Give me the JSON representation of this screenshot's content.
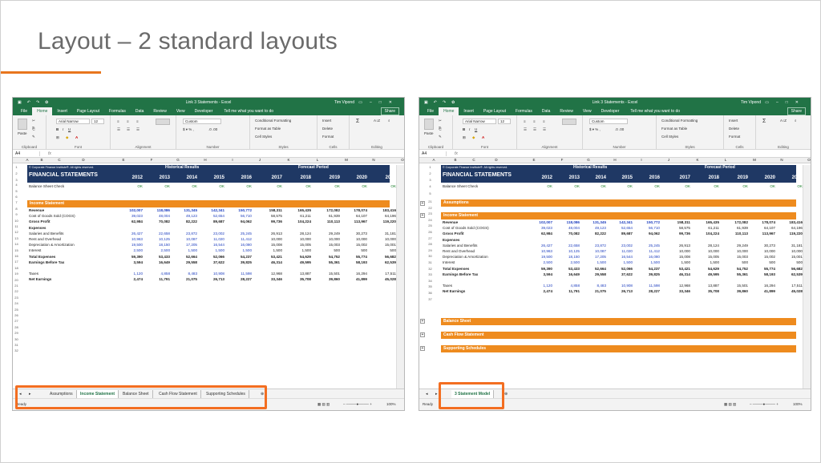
{
  "slide_title": "Layout – 2 standard layouts",
  "accent_color": "#e8761e",
  "excel_green": "#217346",
  "highlight_color": "#f36e21",
  "window_title": "Link 3 Statements - Excel",
  "user": "Tim Vipond",
  "ribbon_tabs": [
    "File",
    "Home",
    "Insert",
    "Page Layout",
    "Formulas",
    "Data",
    "Review",
    "View",
    "Developer"
  ],
  "tell_me": "Tell me what you want to do",
  "share": "Share",
  "font_name": "Arial Narrow",
  "font_size": "12",
  "number_format": "Custom",
  "name_box": "A4",
  "ribbon_labels": {
    "clipboard": "Clipboard",
    "font": "Font",
    "alignment": "Alignment",
    "number": "Number",
    "styles": "Styles",
    "cells": "Cells",
    "editing": "Editing",
    "paste": "Paste",
    "cond": "Conditional Formatting",
    "table": "Format as Table",
    "cellstyles": "Cell Styles",
    "insert": "Insert",
    "delete": "Delete",
    "format": "Format"
  },
  "columns": [
    "A",
    "B",
    "C",
    "D",
    "E",
    "F",
    "G",
    "H",
    "I",
    "J",
    "K",
    "L",
    "M",
    "N",
    "O"
  ],
  "header": {
    "copyright": "© Corporate Finance Institute®. All rights reserved.",
    "historical": "Historical Results",
    "forecast": "Forecast Period",
    "fs": "FINANCIAL STATEMENTS",
    "check": "Balance Sheet Check",
    "ok": "OK"
  },
  "years": [
    "2012",
    "2013",
    "2014",
    "2015",
    "2016",
    "2017",
    "2018",
    "2019",
    "2020",
    "2021"
  ],
  "income_label": "Income Statement",
  "rows": [
    {
      "label": "Revenue",
      "bold": true,
      "v": [
        "102,007",
        "118,086",
        "131,345",
        "142,341",
        "150,772",
        "158,311",
        "165,435",
        "172,082",
        "178,074",
        "183,416"
      ]
    },
    {
      "label": "Cost of Goods Sold (COGS)",
      "v": [
        "39,023",
        "48,004",
        "49,123",
        "52,654",
        "56,710",
        "58,575",
        "61,211",
        "61,939",
        "64,107",
        "64,196"
      ]
    },
    {
      "label": "Gross Profit",
      "bold": true,
      "v": [
        "62,984",
        "70,082",
        "82,222",
        "89,687",
        "94,062",
        "99,736",
        "104,224",
        "110,113",
        "113,967",
        "119,220"
      ]
    },
    {
      "label": "Expenses",
      "bold": true,
      "v": []
    },
    {
      "label": "Salaries and Benefits",
      "v": [
        "26,427",
        "22,658",
        "23,872",
        "23,002",
        "25,245",
        "26,913",
        "28,124",
        "29,249",
        "30,273",
        "31,181"
      ]
    },
    {
      "label": "Rent and Overhead",
      "v": [
        "10,963",
        "10,125",
        "10,087",
        "11,020",
        "11,412",
        "10,000",
        "10,000",
        "10,000",
        "10,000",
        "10,000"
      ]
    },
    {
      "label": "Depreciation & Amortization",
      "v": [
        "19,500",
        "18,150",
        "17,205",
        "16,544",
        "16,080",
        "15,008",
        "15,005",
        "15,003",
        "15,002",
        "15,001"
      ]
    },
    {
      "label": "Interest",
      "v": [
        "2,500",
        "2,500",
        "1,500",
        "1,500",
        "1,500",
        "1,500",
        "1,500",
        "500",
        "500",
        "500"
      ]
    },
    {
      "label": "Total Expenses",
      "bold": true,
      "v": [
        "59,390",
        "53,433",
        "52,664",
        "52,066",
        "54,237",
        "53,421",
        "54,629",
        "54,752",
        "55,774",
        "56,682"
      ]
    },
    {
      "label": "Earnings Before Tax",
      "bold": true,
      "v": [
        "3,594",
        "16,649",
        "29,558",
        "37,622",
        "39,825",
        "46,314",
        "49,595",
        "55,361",
        "58,193",
        "62,539"
      ]
    },
    {
      "label": "",
      "v": []
    },
    {
      "label": "Taxes",
      "v": [
        "1,120",
        "4,858",
        "8,483",
        "10,908",
        "11,598",
        "12,968",
        "13,887",
        "15,501",
        "16,294",
        "17,511"
      ]
    },
    {
      "label": "Net Earnings",
      "bold": true,
      "v": [
        "2,474",
        "11,791",
        "21,075",
        "26,713",
        "28,227",
        "33,346",
        "35,708",
        "39,860",
        "41,899",
        "45,028"
      ]
    }
  ],
  "left_row_nums": [
    "1",
    "2",
    "3",
    "4",
    "5",
    "6",
    "7",
    "8",
    "9",
    "10",
    "11",
    "12",
    "13",
    "14",
    "15",
    "16",
    "17",
    "18",
    "19",
    "20",
    "21",
    "22",
    "23",
    "24",
    "25",
    "26",
    "27",
    "28",
    "29",
    "30",
    "31",
    "32"
  ],
  "right_row_nums_top": [
    "1",
    "2",
    "3",
    "4",
    "5",
    "21",
    "22",
    "23",
    "24",
    "25",
    "26",
    "27",
    "28",
    "29",
    "30",
    "31",
    "32",
    "33",
    "34",
    "35",
    "36",
    "37"
  ],
  "right_sections": [
    "Assumptions",
    "Income Statement",
    "Balance Sheet",
    "Cash Flow Statement",
    "Supporting Schedules"
  ],
  "left_sheets": [
    "Assumptions",
    "Income Statement",
    "Balance Sheet",
    "Cash Flow Statement",
    "Supporting Schedules"
  ],
  "left_active_sheet": "Income Statement",
  "right_sheets": [
    "3 Statement Model"
  ],
  "status_ready": "Ready",
  "zoom": "100%"
}
